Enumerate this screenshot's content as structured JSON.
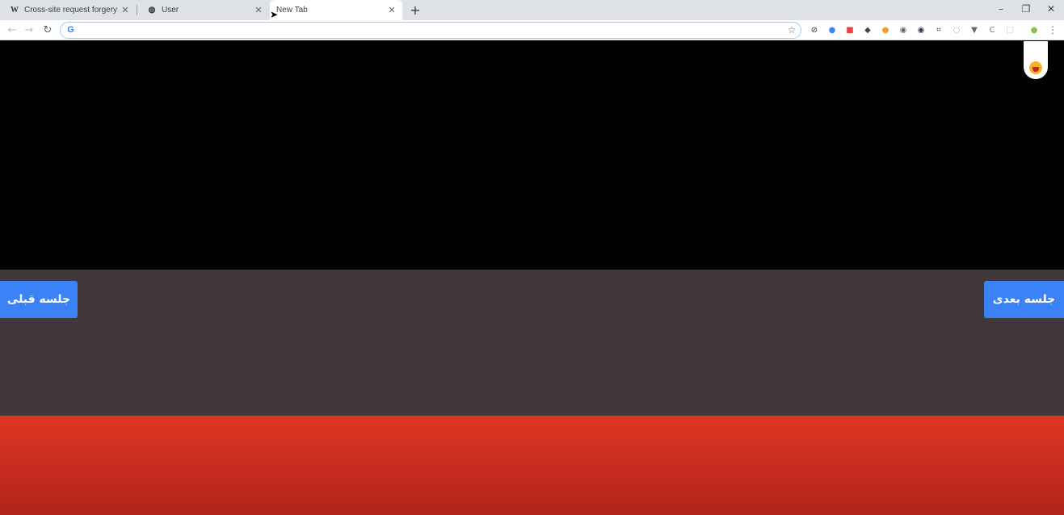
{
  "tabs": [
    {
      "title": "Cross-site request forgery - Wiki",
      "icon": "wikipedia-icon",
      "favicon_glyph": "W",
      "close": "✕"
    },
    {
      "title": "User",
      "icon": "globe-icon",
      "favicon_glyph": "◍",
      "close": "✕"
    },
    {
      "title": "New Tab",
      "icon": "",
      "favicon_glyph": "",
      "close": "✕"
    }
  ],
  "toolbar": {
    "back": "←",
    "forward": "→",
    "reload": "↻",
    "address_value": "",
    "google_glyph": "G",
    "star": "☆",
    "menu": "⋮"
  },
  "window_controls": {
    "minimize": "–",
    "restore": "❐",
    "close": "✕"
  },
  "new_tab": "+",
  "extensions": [
    {
      "name": "block-icon",
      "glyph": "⊘",
      "color": "#333333"
    },
    {
      "name": "circle-blue-icon",
      "glyph": "●",
      "color": "#4285f4"
    },
    {
      "name": "red-notes-icon",
      "glyph": "■",
      "color": "#e8453c"
    },
    {
      "name": "diamond-icon",
      "glyph": "◆",
      "color": "#444444"
    },
    {
      "name": "cookie-icon",
      "glyph": "●",
      "color": "#f0a030"
    },
    {
      "name": "camera-icon",
      "glyph": "◉",
      "color": "#666666"
    },
    {
      "name": "gear-badge-icon",
      "glyph": "◉",
      "color": "#2c3e50"
    },
    {
      "name": "screenshot-icon",
      "glyph": "⌗",
      "color": "#444444"
    },
    {
      "name": "refresh-circle-icon",
      "glyph": "◌",
      "color": "#888888"
    },
    {
      "name": "vue-icon",
      "glyph": "▼",
      "color": "#666666"
    },
    {
      "name": "ci-icon",
      "glyph": "C",
      "color": "#777777"
    },
    {
      "name": "blank-ext-icon",
      "glyph": "□",
      "color": "#cccccc"
    },
    {
      "name": "profile-icon",
      "glyph": "●",
      "color": "#8bc34a"
    }
  ],
  "content": {
    "prev_session": "جلسه قبلی",
    "next_session": "جلسه بعدی"
  }
}
